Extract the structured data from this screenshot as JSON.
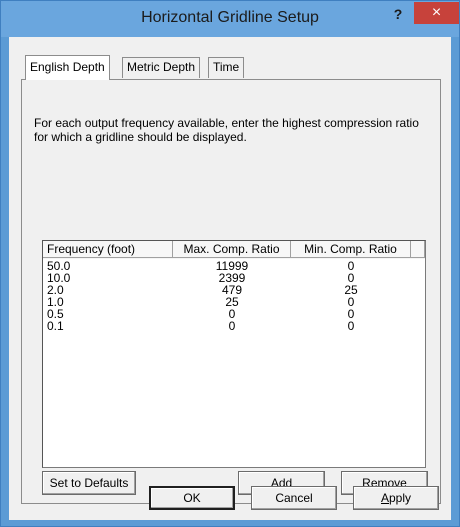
{
  "window": {
    "title": "Horizontal Gridline Setup",
    "help_label": "?",
    "close_label": "×"
  },
  "tabs": [
    {
      "label": "English Depth",
      "active": true
    },
    {
      "label": "Metric Depth",
      "active": false
    },
    {
      "label": "Time",
      "active": false
    }
  ],
  "panel": {
    "instructions": "For each output frequency available, enter the highest compression ratio for which a gridline should be displayed."
  },
  "table": {
    "columns": [
      "Frequency (foot)",
      "Max. Comp. Ratio",
      "Min. Comp. Ratio"
    ],
    "rows": [
      [
        "50.0",
        "11999",
        "0"
      ],
      [
        "10.0",
        "2399",
        "0"
      ],
      [
        "2.0",
        "479",
        "25"
      ],
      [
        "1.0",
        "25",
        "0"
      ],
      [
        "0.5",
        "0",
        "0"
      ],
      [
        "0.1",
        "0",
        "0"
      ]
    ]
  },
  "panel_buttons": {
    "defaults": "Set to Defaults",
    "add": "Add",
    "remove": "Remove"
  },
  "dialog_buttons": {
    "ok": "OK",
    "cancel": "Cancel",
    "apply_first": "A",
    "apply_rest": "pply"
  }
}
